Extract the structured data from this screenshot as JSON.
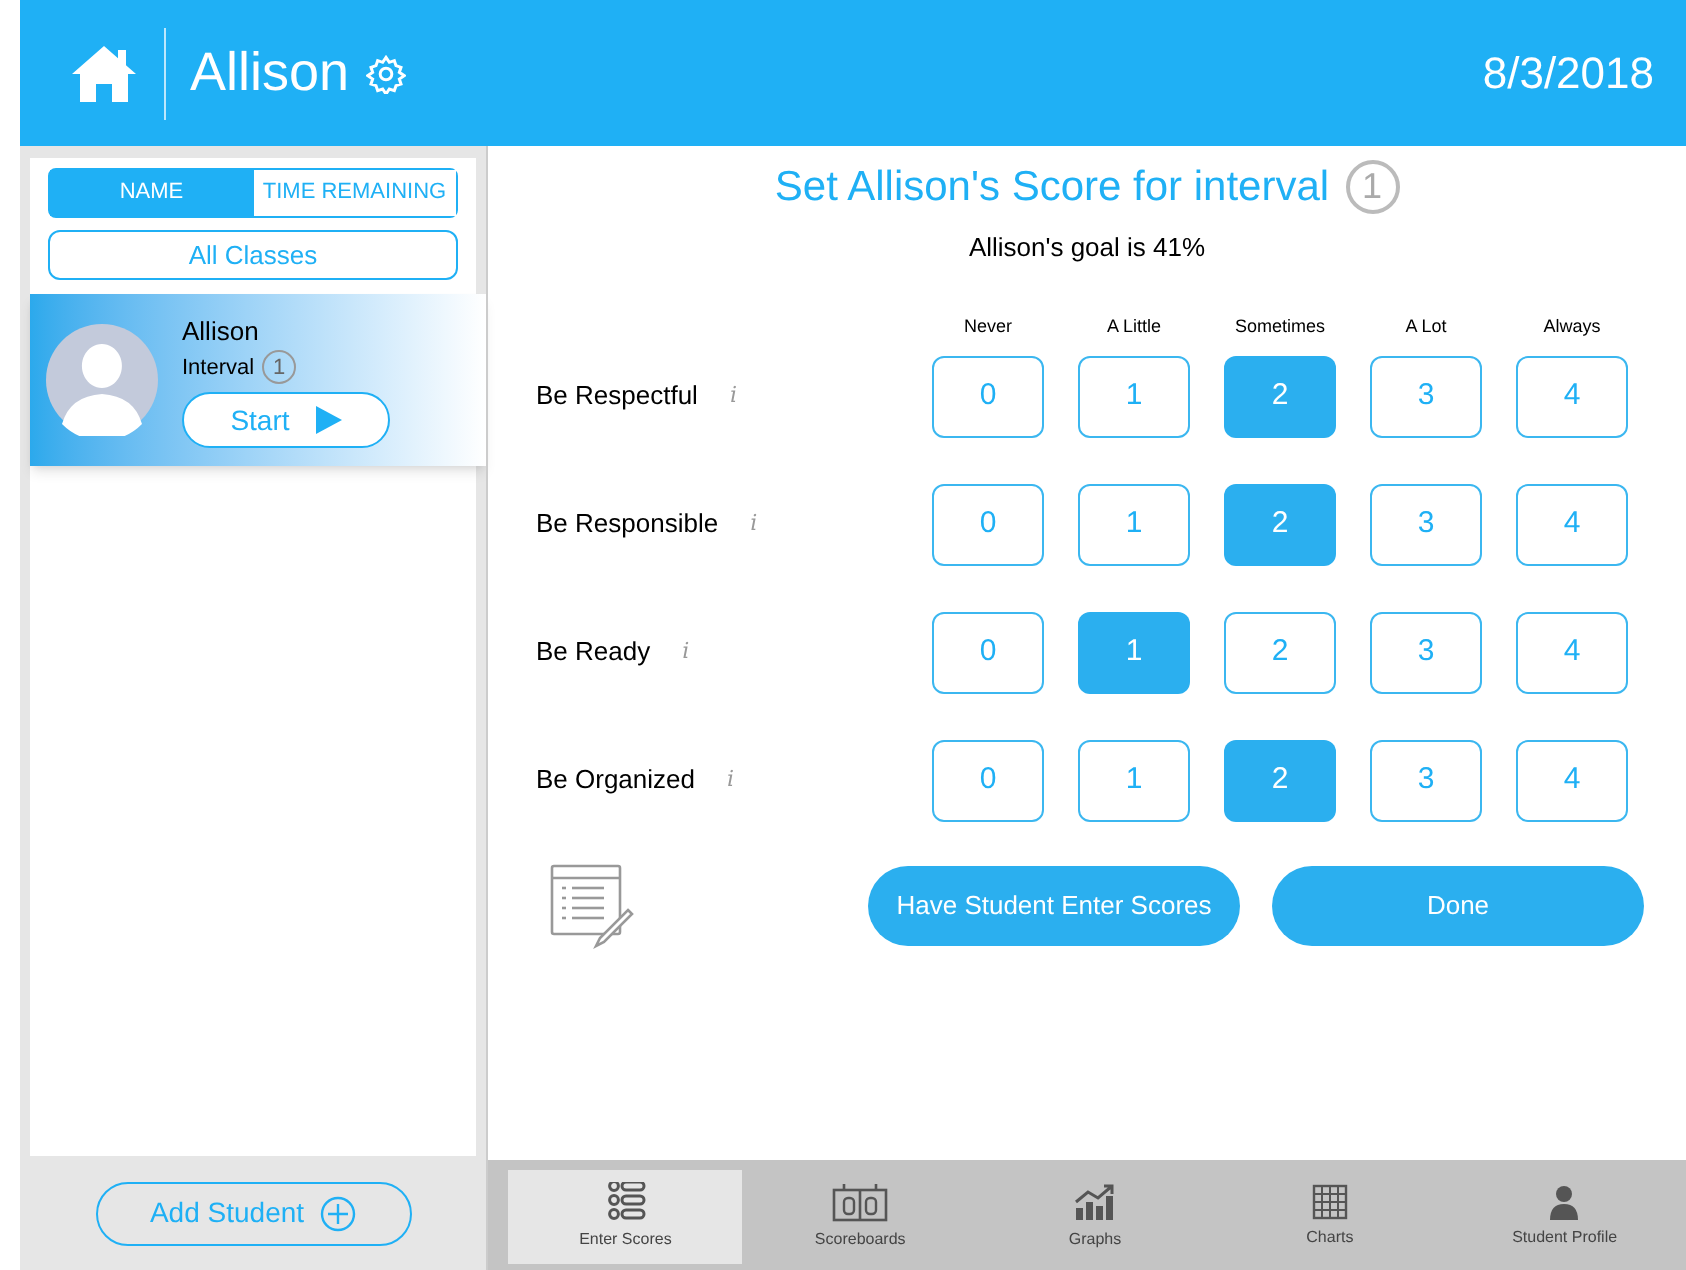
{
  "header": {
    "title": "Allison",
    "date": "8/3/2018"
  },
  "sidebar": {
    "sort_tabs": [
      {
        "label": "NAME",
        "selected": true
      },
      {
        "label": "TIME REMAINING",
        "selected": false
      }
    ],
    "class_filter": "All Classes",
    "students": [
      {
        "name": "Allison",
        "interval_label": "Interval",
        "interval": "1",
        "start": "Start",
        "selected": true
      }
    ],
    "add_button": "Add Student"
  },
  "main": {
    "title": "Set Allison's Score for interval",
    "interval": "1",
    "goal": "Allison's goal is 41%",
    "scale": [
      "Never",
      "A Little",
      "Sometimes",
      "A Lot",
      "Always"
    ],
    "behaviors": [
      {
        "name": "Be Respectful",
        "info": "i",
        "options": [
          {
            "label": "0",
            "selected": false
          },
          {
            "label": "1",
            "selected": false
          },
          {
            "label": "2",
            "selected": true
          },
          {
            "label": "3",
            "selected": false
          },
          {
            "label": "4",
            "selected": false
          }
        ]
      },
      {
        "name": "Be Responsible",
        "info": "i",
        "options": [
          {
            "label": "0",
            "selected": false
          },
          {
            "label": "1",
            "selected": false
          },
          {
            "label": "2",
            "selected": true
          },
          {
            "label": "3",
            "selected": false
          },
          {
            "label": "4",
            "selected": false
          }
        ]
      },
      {
        "name": "Be Ready",
        "info": "i",
        "options": [
          {
            "label": "0",
            "selected": false
          },
          {
            "label": "1",
            "selected": true
          },
          {
            "label": "2",
            "selected": false
          },
          {
            "label": "3",
            "selected": false
          },
          {
            "label": "4",
            "selected": false
          }
        ]
      },
      {
        "name": "Be Organized",
        "info": "i",
        "options": [
          {
            "label": "0",
            "selected": false
          },
          {
            "label": "1",
            "selected": false
          },
          {
            "label": "2",
            "selected": true
          },
          {
            "label": "3",
            "selected": false
          },
          {
            "label": "4",
            "selected": false
          }
        ]
      }
    ],
    "buttons": [
      "Have Student Enter Scores",
      "Done"
    ]
  },
  "tab_bar": [
    {
      "kind": "scores",
      "label": "Enter Scores",
      "selected": true
    },
    {
      "kind": "scoreboards",
      "label": "Scoreboards",
      "selected": false
    },
    {
      "kind": "graphs",
      "label": "Graphs",
      "selected": false
    },
    {
      "kind": "charts",
      "label": "Charts",
      "selected": false
    },
    {
      "kind": "profile",
      "label": "Student Profile",
      "selected": false
    }
  ]
}
